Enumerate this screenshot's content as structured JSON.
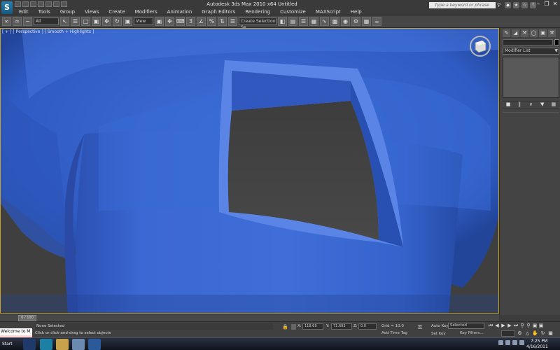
{
  "title_bar": {
    "logo_text": "S",
    "window_title": "Autodesk 3ds Max  2010 x64       Untitled",
    "search_placeholder": "Type a keyword or phrase"
  },
  "menu": [
    "Edit",
    "Tools",
    "Group",
    "Views",
    "Create",
    "Modifiers",
    "Animation",
    "Graph Editors",
    "Rendering",
    "Customize",
    "MAXScript",
    "Help"
  ],
  "toolbar": {
    "selection_filter": "All",
    "reference_coord": "View",
    "named_selection_placeholder": "Create Selection Se"
  },
  "viewport": {
    "label": "[ + ] [ Perspective ] [ Smooth + Highlights ]",
    "object_color": "#3a6ad4",
    "background_color": "#3f3f3f",
    "active_border_color": "#c8a227"
  },
  "command_panel": {
    "modifier_list": "Modifier List"
  },
  "timeline": {
    "slider": "0 / 100"
  },
  "status_bar": {
    "listener": "Welcome to M",
    "selection": "None Selected",
    "prompt": "Click or click-and-drag to select objects",
    "x_label": "X:",
    "x_value": "118.69",
    "y_label": "Y:",
    "y_value": "71.693",
    "z_label": "Z:",
    "z_value": "0.0",
    "grid": "Grid = 10.0",
    "add_time_tag": "Add Time Tag",
    "auto_key": "Auto Key",
    "set_key": "Set Key",
    "selected_dropdown": "Selected",
    "key_filters": "Key Filters..."
  },
  "taskbar": {
    "start": "Start",
    "time": "7:25 PM",
    "date": "4/16/2011"
  }
}
